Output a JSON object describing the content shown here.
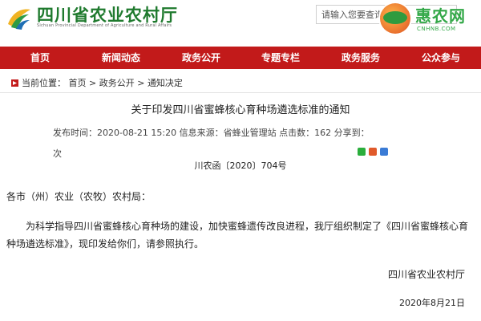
{
  "header": {
    "site_title": "四川省农业农村厅",
    "site_subtitle": "Sichuan Provincial Department of Agriculture and Rural Affairs",
    "search_placeholder": "请输入您要查询的内容",
    "badge_name": "惠农网",
    "badge_domain": "CNHNB.COM",
    "brand_color": "#1f7a2e",
    "badge_color": "#33a848"
  },
  "nav": {
    "background": "#c21a1a",
    "items": [
      {
        "label": "首页"
      },
      {
        "label": "新闻动态"
      },
      {
        "label": "政务公开"
      },
      {
        "label": "专题专栏"
      },
      {
        "label": "政务服务"
      },
      {
        "label": "公众参与"
      }
    ]
  },
  "breadcrumb": {
    "prefix": "当前位置：",
    "items": [
      "首页",
      "政务公开",
      "通知决定"
    ],
    "separator": " > "
  },
  "article": {
    "title": "关于印发四川省蜜蜂核心育种场遴选标准的通知",
    "meta_line": "发布时间：2020-08-21 15:20  信息来源：省蜂业管理站  点击数：162  分享到：",
    "meta_line2": "次",
    "doc_number": "川农函〔2020〕704号",
    "addressee": "各市（州）农业（农牧）农村局：",
    "body": "为科学指导四川省蜜蜂核心育种场的建设，加快蜜蜂遗传改良进程，我厅组织制定了《四川省蜜蜂核心育种场遴选标准》，现印发给你们，请参照执行。",
    "signature": "四川省农业农村厅",
    "date": "2020年8月21日"
  }
}
